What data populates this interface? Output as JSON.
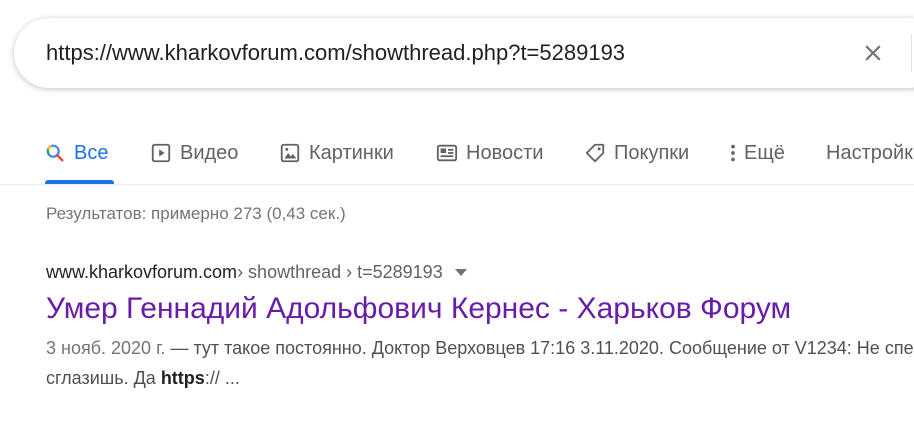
{
  "search": {
    "query": "https://www.kharkovforum.com/showthread.php?t=5289193",
    "clear_icon": "close-icon"
  },
  "tabs": [
    {
      "label": "Все",
      "icon": "search-icon",
      "active": true
    },
    {
      "label": "Видео",
      "icon": "play-icon",
      "active": false
    },
    {
      "label": "Картинки",
      "icon": "image-icon",
      "active": false
    },
    {
      "label": "Новости",
      "icon": "news-icon",
      "active": false
    },
    {
      "label": "Покупки",
      "icon": "tag-icon",
      "active": false
    },
    {
      "label": "Ещё",
      "icon": "more-vert-icon",
      "active": false
    },
    {
      "label": "Настройки",
      "icon": "",
      "active": false
    }
  ],
  "stats": "Результатов: примерно 273 (0,43 сек.)",
  "result": {
    "domain": "www.kharkovforum.com",
    "path": " › showthread › t=5289193",
    "title": "Умер Геннадий Адольфович Кернес - Харьков Форум",
    "date": "3 нояб. 2020 г.",
    "snippet_before": " — тут такое постоянно. Доктор Верховцев 17:16 3.11.2020. Сообщение от V1234: Не спеши, сглазишь. Да ",
    "snippet_bold": "https",
    "snippet_after": ":// ..."
  },
  "colors": {
    "accent": "#1a73e8",
    "visited_link": "#681da8",
    "muted": "#70757a"
  }
}
